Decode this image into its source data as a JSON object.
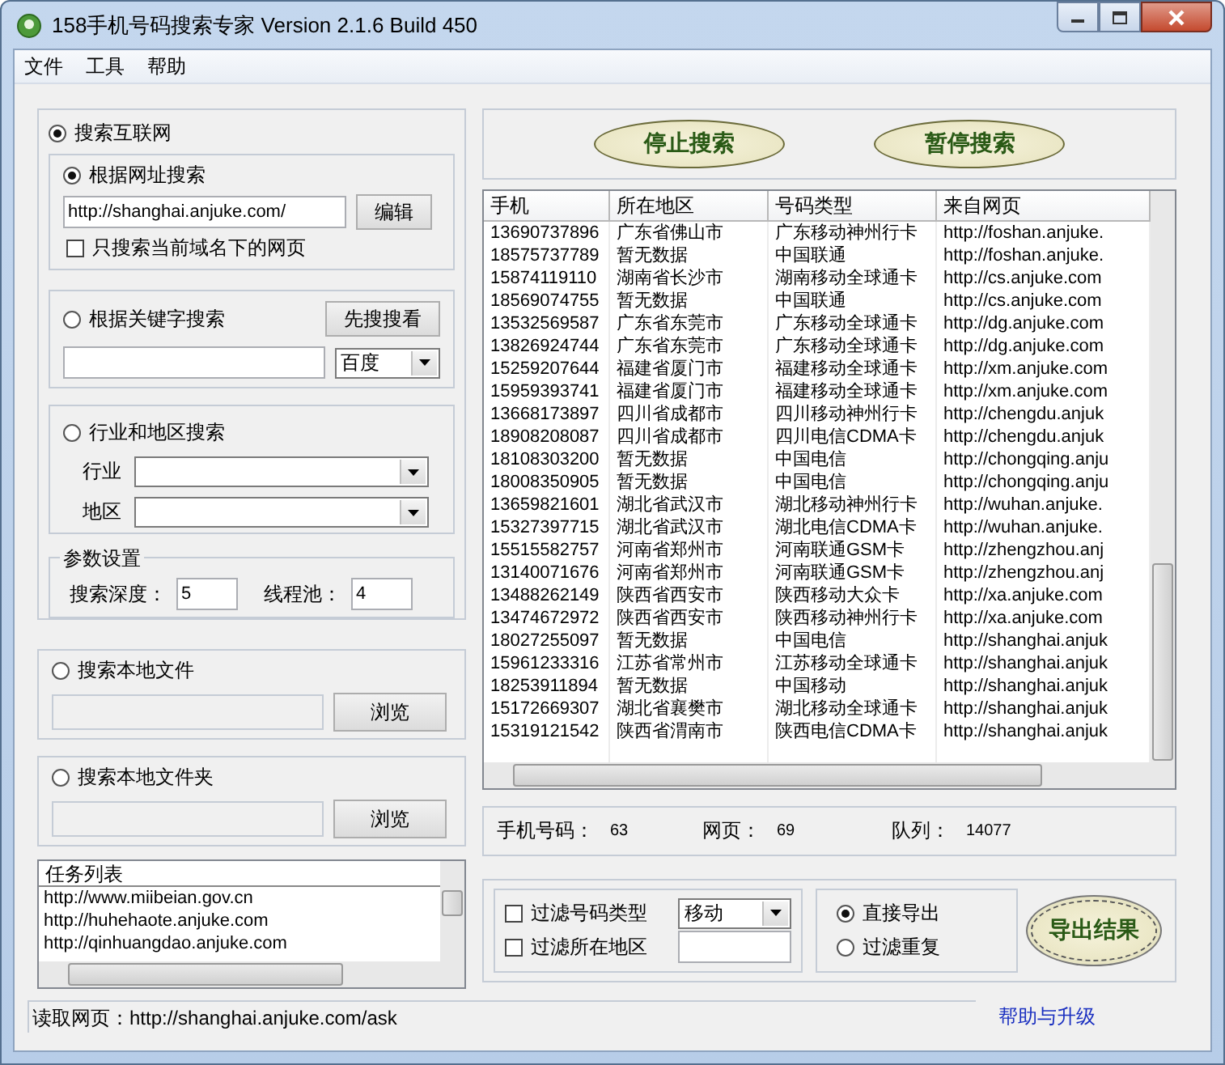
{
  "window": {
    "title": "158手机号码搜索专家 Version 2.1.6 Build 450"
  },
  "menu": [
    {
      "label": "文件"
    },
    {
      "label": "工具"
    },
    {
      "label": "帮助"
    }
  ],
  "internet_search": {
    "label": "搜索互联网",
    "selected": true,
    "url_search": {
      "label": "根据网址搜索",
      "selected": true,
      "url": "http://shanghai.anjuke.com/",
      "edit_button": "编辑",
      "domain_only": {
        "label": "只搜索当前域名下的网页",
        "checked": false
      }
    },
    "keyword_search": {
      "label": "根据关键字搜索",
      "selected": false,
      "preview_button": "先搜搜看",
      "engine": "百度"
    },
    "industry_search": {
      "label": "行业和地区搜索",
      "selected": false,
      "industry_label": "行业",
      "region_label": "地区"
    },
    "params": {
      "title": "参数设置",
      "depth_label": "搜索深度：",
      "depth": "5",
      "pool_label": "线程池：",
      "pool": "4"
    }
  },
  "local_file": {
    "label": "搜索本地文件",
    "selected": false,
    "browse_button": "浏览"
  },
  "local_folder": {
    "label": "搜索本地文件夹",
    "selected": false,
    "browse_button": "浏览"
  },
  "task_list": {
    "header": "任务列表",
    "items": [
      "http://www.miibeian.gov.cn",
      "http://huhehaote.anjuke.com",
      "http://qinhuangdao.anjuke.com"
    ]
  },
  "status_bar": {
    "text": "读取网页：http://shanghai.anjuke.com/ask",
    "help_link": "帮助与升级"
  },
  "actions": [
    {
      "label": "停止搜索"
    },
    {
      "label": "暂停搜索"
    }
  ],
  "results": {
    "columns": [
      "手机",
      "所在地区",
      "号码类型",
      "来自网页"
    ],
    "rows": [
      [
        "13690737896",
        "广东省佛山市",
        "广东移动神州行卡",
        "http://foshan.anjuke."
      ],
      [
        "18575737789",
        "暂无数据",
        "中国联通",
        "http://foshan.anjuke."
      ],
      [
        "15874119110",
        "湖南省长沙市",
        "湖南移动全球通卡",
        "http://cs.anjuke.com"
      ],
      [
        "18569074755",
        "暂无数据",
        "中国联通",
        "http://cs.anjuke.com"
      ],
      [
        "13532569587",
        "广东省东莞市",
        "广东移动全球通卡",
        "http://dg.anjuke.com"
      ],
      [
        "13826924744",
        "广东省东莞市",
        "广东移动全球通卡",
        "http://dg.anjuke.com"
      ],
      [
        "15259207644",
        "福建省厦门市",
        "福建移动全球通卡",
        "http://xm.anjuke.com"
      ],
      [
        "15959393741",
        "福建省厦门市",
        "福建移动全球通卡",
        "http://xm.anjuke.com"
      ],
      [
        "13668173897",
        "四川省成都市",
        "四川移动神州行卡",
        "http://chengdu.anjuk"
      ],
      [
        "18908208087",
        "四川省成都市",
        "四川电信CDMA卡",
        "http://chengdu.anjuk"
      ],
      [
        "18108303200",
        "暂无数据",
        "中国电信",
        "http://chongqing.anju"
      ],
      [
        "18008350905",
        "暂无数据",
        "中国电信",
        "http://chongqing.anju"
      ],
      [
        "13659821601",
        "湖北省武汉市",
        "湖北移动神州行卡",
        "http://wuhan.anjuke."
      ],
      [
        "15327397715",
        "湖北省武汉市",
        "湖北电信CDMA卡",
        "http://wuhan.anjuke."
      ],
      [
        "15515582757",
        "河南省郑州市",
        "河南联通GSM卡",
        "http://zhengzhou.anj"
      ],
      [
        "13140071676",
        "河南省郑州市",
        "河南联通GSM卡",
        "http://zhengzhou.anj"
      ],
      [
        "13488262149",
        "陕西省西安市",
        "陕西移动大众卡",
        "http://xa.anjuke.com"
      ],
      [
        "13474672972",
        "陕西省西安市",
        "陕西移动神州行卡",
        "http://xa.anjuke.com"
      ],
      [
        "18027255097",
        "暂无数据",
        "中国电信",
        "http://shanghai.anjuk"
      ],
      [
        "15961233316",
        "江苏省常州市",
        "江苏移动全球通卡",
        "http://shanghai.anjuk"
      ],
      [
        "18253911894",
        "暂无数据",
        "中国移动",
        "http://shanghai.anjuk"
      ],
      [
        "15172669307",
        "湖北省襄樊市",
        "湖北移动全球通卡",
        "http://shanghai.anjuk"
      ],
      [
        "15319121542",
        "陕西省渭南市",
        "陕西电信CDMA卡",
        "http://shanghai.anjuk"
      ]
    ]
  },
  "stats": [
    {
      "label": "手机号码：",
      "value": "63"
    },
    {
      "label": "网页：",
      "value": "69"
    },
    {
      "label": "队列：",
      "value": "14077"
    }
  ],
  "filters": [
    {
      "label": "过滤号码类型",
      "checked": false,
      "kind": "select",
      "value": "移动"
    },
    {
      "label": "过滤所在地区",
      "checked": false,
      "kind": "input"
    }
  ],
  "export_modes": [
    {
      "label": "直接导出",
      "selected": true
    },
    {
      "label": "过滤重复",
      "selected": false
    }
  ],
  "export_button": "导出结果"
}
